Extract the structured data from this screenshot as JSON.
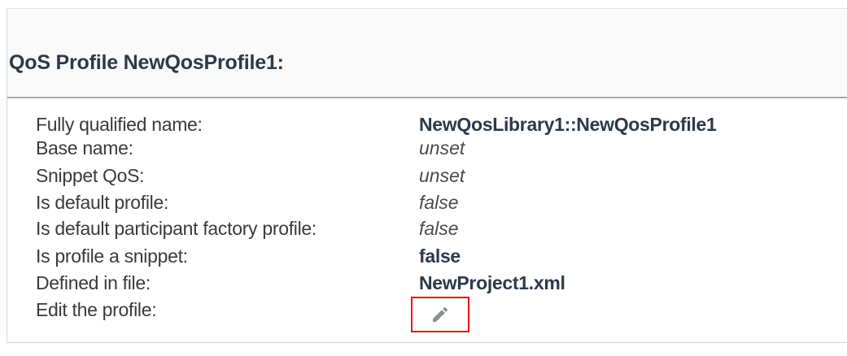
{
  "profile": {
    "title": "QoS Profile NewQosProfile1:"
  },
  "properties": [
    {
      "label": "Fully qualified name:",
      "value": "NewQosLibrary1::NewQosProfile1",
      "style": "bold"
    },
    {
      "label": "Base name:",
      "value": "unset",
      "style": "italic"
    },
    {
      "label": "Snippet QoS:",
      "value": "unset",
      "style": "italic"
    },
    {
      "label": "Is default profile:",
      "value": "false",
      "style": "italic"
    },
    {
      "label": "Is default participant factory profile:",
      "value": "false",
      "style": "italic"
    },
    {
      "label": "Is profile a snippet:",
      "value": "false",
      "style": "bold"
    },
    {
      "label": "Defined in file:",
      "value": "NewProject1.xml",
      "style": "bold"
    },
    {
      "label": "Edit the profile:",
      "value": null,
      "style": "button"
    }
  ],
  "edit_button": {
    "icon": "pencil-icon",
    "highlight_color": "#e3191b",
    "icon_color": "#8a8f96"
  }
}
